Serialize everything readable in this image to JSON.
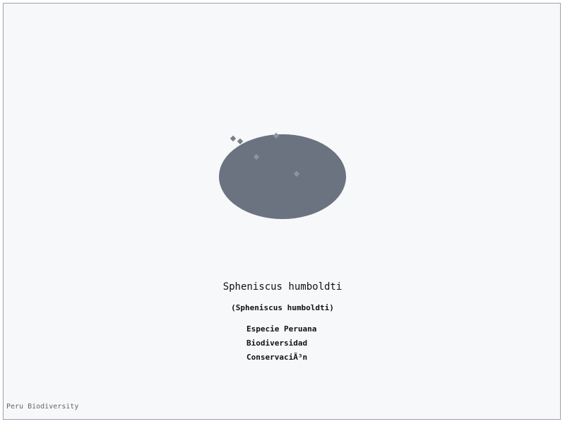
{
  "species": {
    "common_name": "Spheniscus humboldti",
    "scientific_name": "(Spheniscus humboldti)",
    "tags": [
      "Especie Peruana",
      "Biodiversidad",
      "ConservaciÃ³n"
    ]
  },
  "footer": {
    "label": "Peru Biodiversity"
  },
  "colors": {
    "frame_border": "#9aa1ab",
    "background": "#f7f8fa",
    "blob": "#6b7280",
    "dots": "#8e949d"
  }
}
